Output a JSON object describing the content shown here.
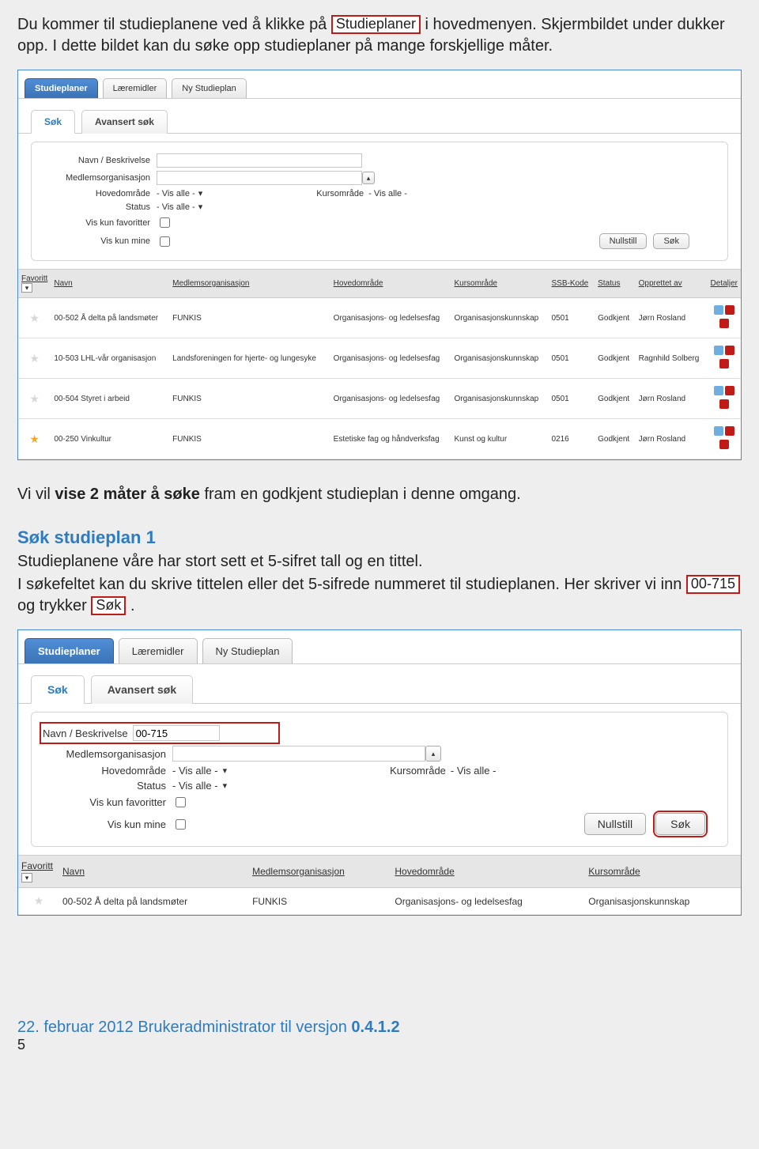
{
  "intro": {
    "t1a": "Du kommer til studieplanene ved å klikke på",
    "studieplaner_box": "Studieplaner",
    "t1b": " i hovedmenyen. Skjermbildet under dukker opp. I dette bildet kan du søke opp studieplaner på mange forskjellige måter."
  },
  "shot1": {
    "toptabs": [
      "Studieplaner",
      "Læremidler",
      "Ny Studieplan"
    ],
    "subtabs": [
      "Søk",
      "Avansert søk"
    ],
    "labels": {
      "navn": "Navn / Beskrivelse",
      "medlem": "Medlemsorganisasjon",
      "hoved": "Hovedområde",
      "kursom": "Kursområde",
      "status": "Status",
      "fav": "Vis kun favoritter",
      "mine": "Vis kun mine",
      "visalle": "- Vis alle -"
    },
    "buttons": {
      "nullstill": "Nullstill",
      "sok": "Søk"
    },
    "cols": [
      "Navn",
      "Medlemsorganisasjon",
      "Hovedområde",
      "Kursområde",
      "SSB-Kode",
      "Status",
      "Opprettet av",
      "Detaljer"
    ],
    "favcol": "Favoritt",
    "rows": [
      {
        "fav": false,
        "navn": "00-502 Å delta på landsmøter",
        "org": "FUNKIS",
        "hoved": "Organisasjons- og ledelsesfag",
        "kurs": "Organisasjonskunnskap",
        "ssb": "0501",
        "status": "Godkjent",
        "av": "Jørn Rosland"
      },
      {
        "fav": false,
        "navn": "10-503 LHL-vår organisasjon",
        "org": "Landsforeningen for hjerte- og lungesyke",
        "hoved": "Organisasjons- og ledelsesfag",
        "kurs": "Organisasjonskunnskap",
        "ssb": "0501",
        "status": "Godkjent",
        "av": "Ragnhild Solberg"
      },
      {
        "fav": false,
        "navn": "00-504 Styret i arbeid",
        "org": "FUNKIS",
        "hoved": "Organisasjons- og ledelsesfag",
        "kurs": "Organisasjonskunnskap",
        "ssb": "0501",
        "status": "Godkjent",
        "av": "Jørn Rosland"
      },
      {
        "fav": true,
        "navn": "00-250 Vinkultur",
        "org": "FUNKIS",
        "hoved": "Estetiske fag og håndverksfag",
        "kurs": "Kunst og kultur",
        "ssb": "0216",
        "status": "Godkjent",
        "av": "Jørn Rosland"
      }
    ]
  },
  "mid": {
    "p1a": "Vi vil ",
    "p1b": "vise 2 måter å søke",
    "p1c": " fram en godkjent studieplan i denne omgang.",
    "h2": "Søk studieplan 1",
    "p2": "Studieplanene våre har stort sett et 5-sifret tall og en tittel.",
    "p3a": "I søkefeltet kan du skrive tittelen eller det 5-sifrede nummeret til studieplanen. Her skriver vi inn ",
    "box_00715": "00-715",
    "p3b": " og trykker ",
    "box_sok": "Søk",
    "p3c": " ."
  },
  "shot2": {
    "navn_value": "00-715",
    "cols": [
      "Navn",
      "Medlemsorganisasjon",
      "Hovedområde",
      "Kursområde"
    ],
    "row": {
      "navn": "00-502 Å delta på landsmøter",
      "org": "FUNKIS",
      "hoved": "Organisasjons- og ledelsesfag",
      "kurs": "Organisasjonskunnskap"
    }
  },
  "footer": {
    "date": "22. februar 2012 Brukeradministrator til versjon ",
    "ver": "0.4.1.2",
    "page": "5"
  }
}
